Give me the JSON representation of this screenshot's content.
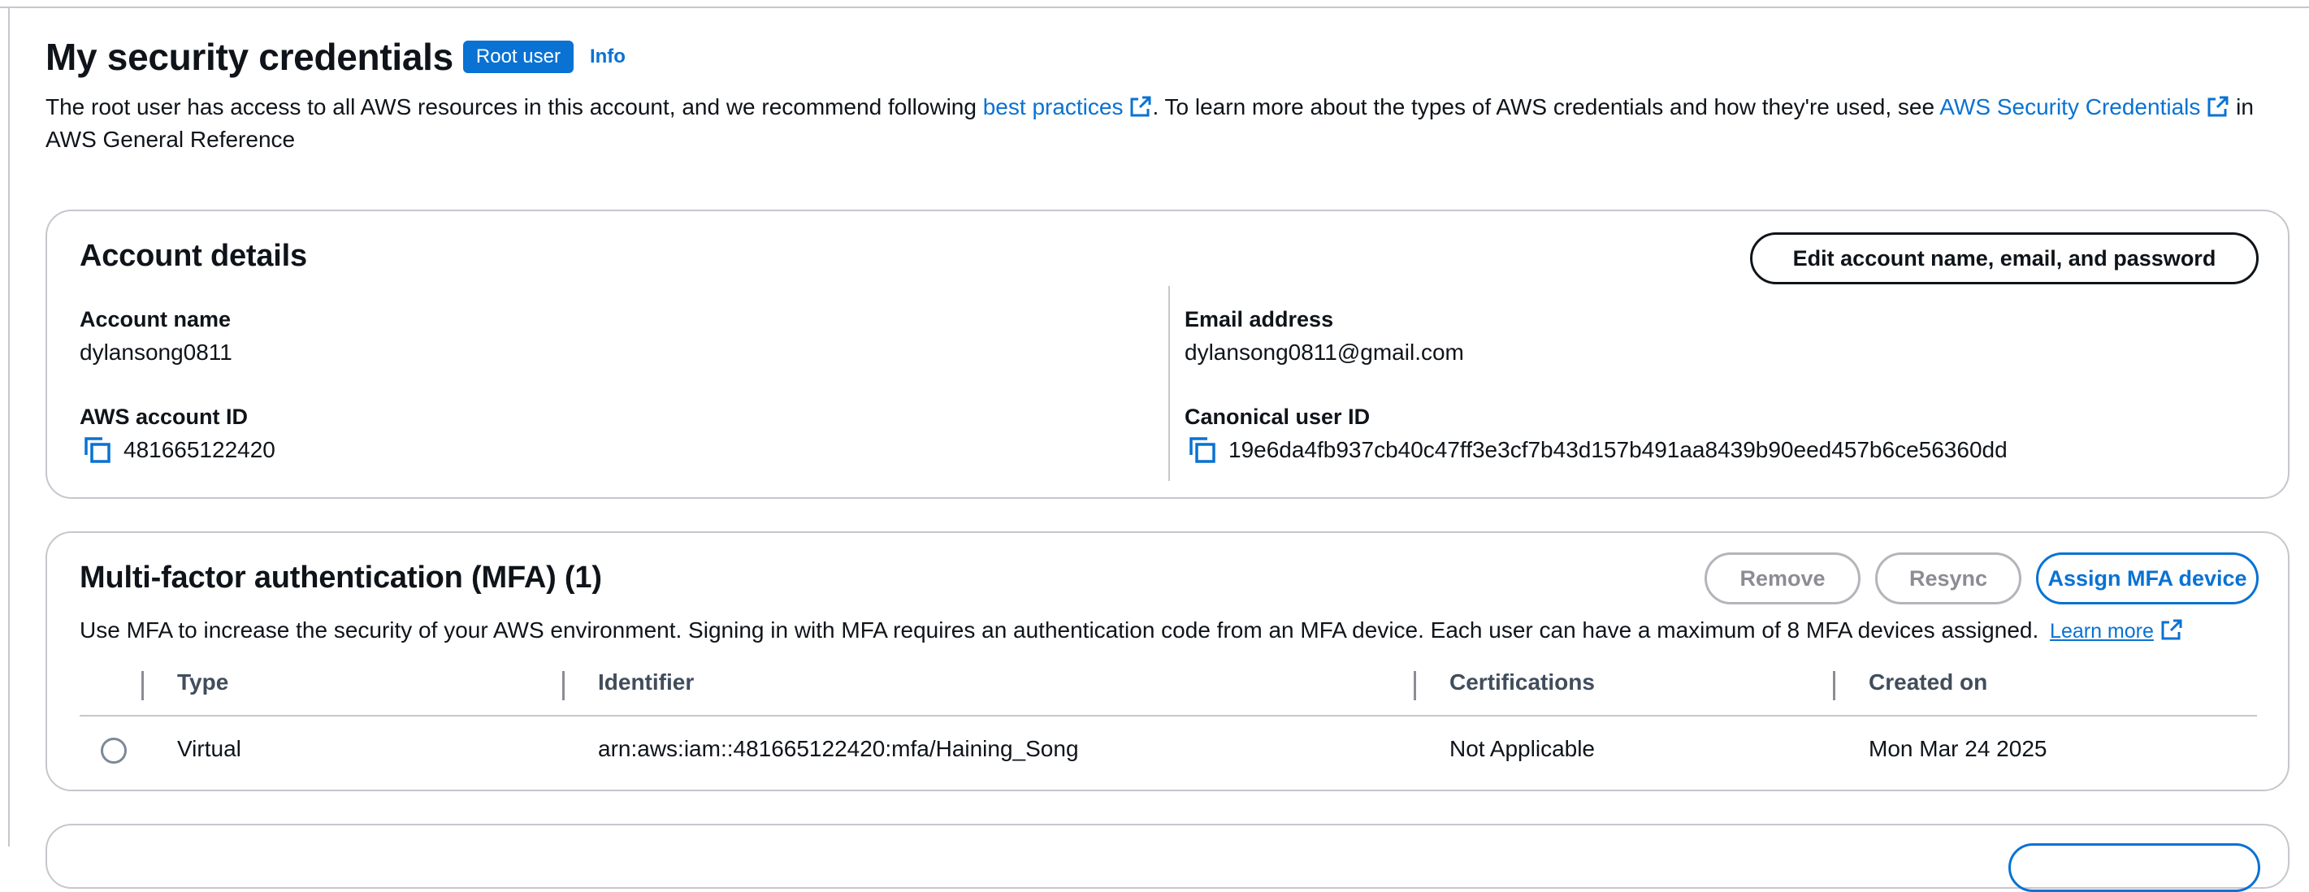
{
  "page": {
    "title": "My security credentials",
    "badge": "Root user",
    "info_link": "Info",
    "description_part1": "The root user has access to all AWS resources in this account, and we recommend following ",
    "best_practices_link": "best practices",
    "description_part2": ". To learn more about the types of AWS credentials and how they're used, see ",
    "aws_security_credentials_link": "AWS Security Credentials",
    "description_part3": " in AWS General Reference"
  },
  "account_details": {
    "title": "Account details",
    "edit_button": "Edit account name, email, and password",
    "account_name_label": "Account name",
    "account_name_value": "dylansong0811",
    "account_id_label": "AWS account ID",
    "account_id_value": "481665122420",
    "email_label": "Email address",
    "email_value": "dylansong0811@gmail.com",
    "canonical_id_label": "Canonical user ID",
    "canonical_id_value": "19e6da4fb937cb40c47ff3e3cf7b43d157b491aa8439b90eed457b6ce56360dd"
  },
  "mfa": {
    "title": "Multi-factor authentication (MFA) (1)",
    "remove_button": "Remove",
    "resync_button": "Resync",
    "assign_button": "Assign MFA device",
    "description": "Use MFA to increase the security of your AWS environment. Signing in with MFA requires an authentication code from an MFA device. Each user can have a maximum of 8 MFA devices assigned.",
    "learn_more": "Learn more",
    "columns": [
      "Type",
      "Identifier",
      "Certifications",
      "Created on"
    ],
    "rows": [
      {
        "type": "Virtual",
        "identifier": "arn:aws:iam::481665122420:mfa/Haining_Song",
        "certifications": "Not Applicable",
        "created_on": "Mon Mar 24 2025"
      }
    ]
  },
  "colors": {
    "accent": "#0972d3",
    "border": "#c6c6cd",
    "text": "#0f141a",
    "disabled": "#8c8c94"
  },
  "icons": {
    "external_link": "external-link-icon",
    "copy": "copy-icon",
    "radio": "radio-button"
  }
}
